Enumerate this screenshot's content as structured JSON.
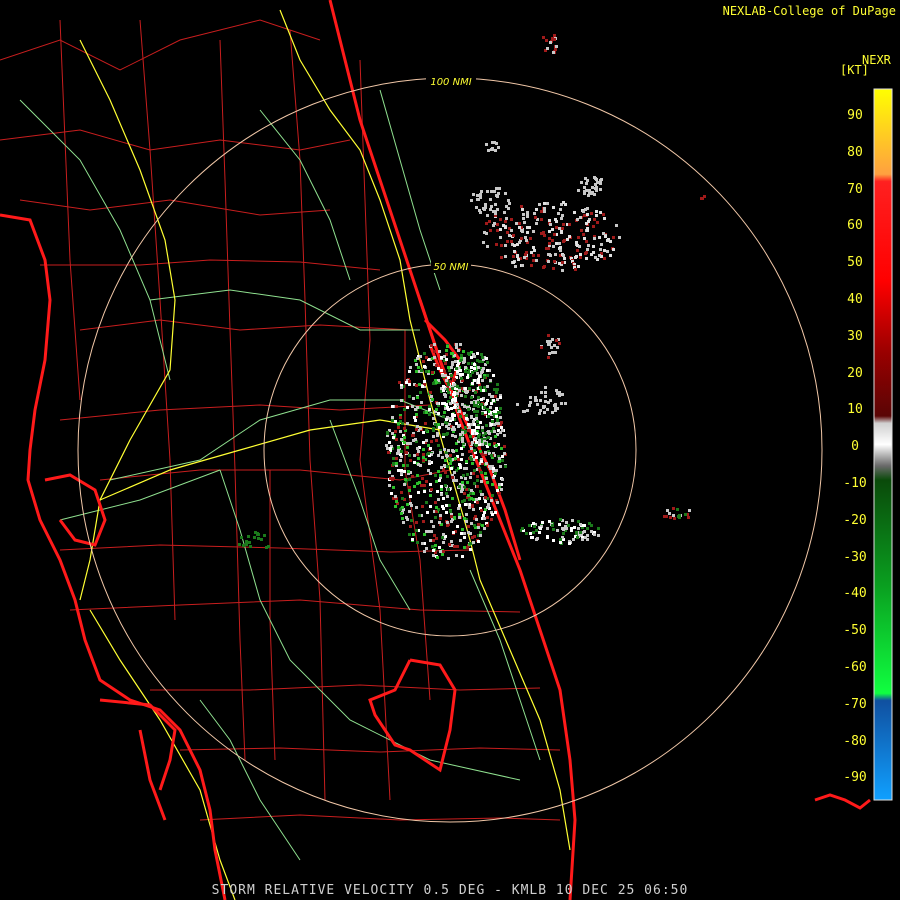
{
  "header": {
    "credit": "NEXLAB-College of DuPage"
  },
  "footer": {
    "title": "STORM RELATIVE VELOCITY 0.5 DEG - KMLB 10 DEC 25 06:50"
  },
  "range_rings": [
    {
      "label": "100 NMI"
    },
    {
      "label": "50 NMI"
    }
  ],
  "legend": {
    "product": "NEXR",
    "unit": "[KT]",
    "ticks": [
      "90",
      "80",
      "70",
      "60",
      "50",
      "40",
      "30",
      "20",
      "10",
      "0",
      "-10",
      "-20",
      "-30",
      "-40",
      "-50",
      "-60",
      "-70",
      "-80",
      "-90"
    ]
  },
  "colors": {
    "coast": "#ff1a1a",
    "county": "#c81e1e",
    "highway": "#ffff33",
    "road": "#8fe08f",
    "ring": "#f2c8a8",
    "outbound": "#a01a1a",
    "inbound": "#1b7a1b",
    "nearzero": "#c8c8c8"
  }
}
